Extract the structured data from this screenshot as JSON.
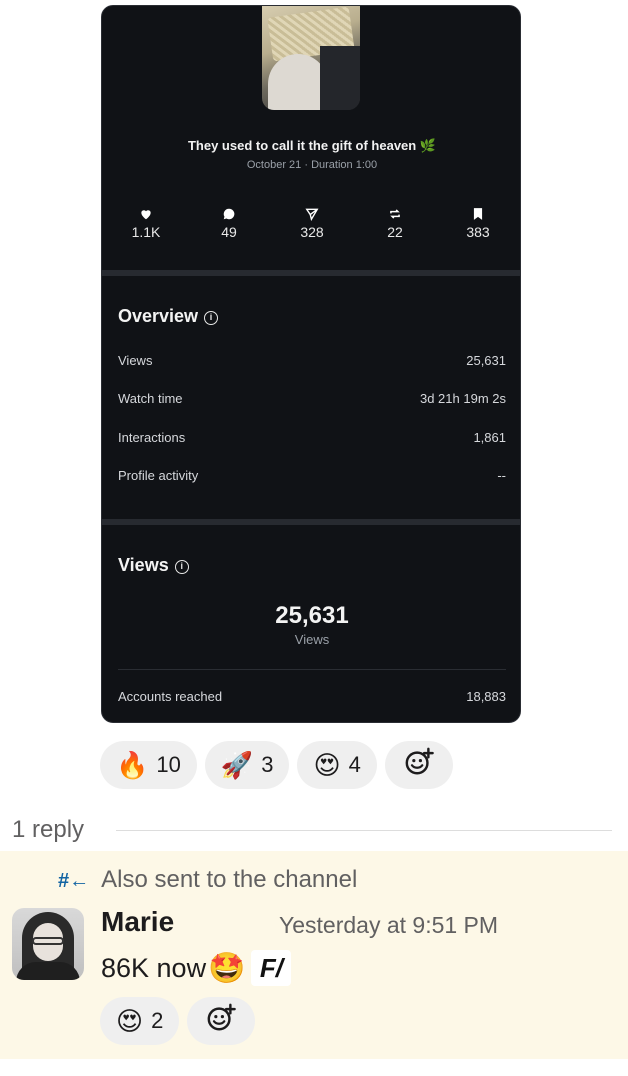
{
  "post": {
    "title": "They used to call it the gift of heaven 🌿",
    "meta": "October 21 · Duration 1:00",
    "stats": [
      {
        "icon": "heart-icon",
        "value": "1.1K"
      },
      {
        "icon": "comment-icon",
        "value": "49"
      },
      {
        "icon": "send-icon",
        "value": "328"
      },
      {
        "icon": "repost-icon",
        "value": "22"
      },
      {
        "icon": "bookmark-icon",
        "value": "383"
      }
    ]
  },
  "overview": {
    "title": "Overview",
    "rows": [
      {
        "label": "Views",
        "value": "25,631"
      },
      {
        "label": "Watch time",
        "value": "3d 21h 19m 2s"
      },
      {
        "label": "Interactions",
        "value": "1,861"
      },
      {
        "label": "Profile activity",
        "value": "--"
      }
    ]
  },
  "views": {
    "title": "Views",
    "big_number": "25,631",
    "big_label": "Views",
    "accounts_label": "Accounts reached",
    "accounts_value": "18,883"
  },
  "reactions": [
    {
      "emoji": "🔥",
      "count": "10"
    },
    {
      "emoji": "🚀",
      "count": "3"
    },
    {
      "emoji": "😍",
      "count": "4"
    }
  ],
  "thread": {
    "reply_count": "1 reply",
    "also_sent_icon": "#←",
    "also_sent": "Also sent to the channel",
    "author": "Marie",
    "timestamp": "Yesterday at 9:51 PM",
    "message_text": "86K now",
    "message_emoji": "🤩",
    "custom_emoji_text": "F/",
    "reactions": [
      {
        "emoji": "😍",
        "count": "2"
      }
    ]
  }
}
